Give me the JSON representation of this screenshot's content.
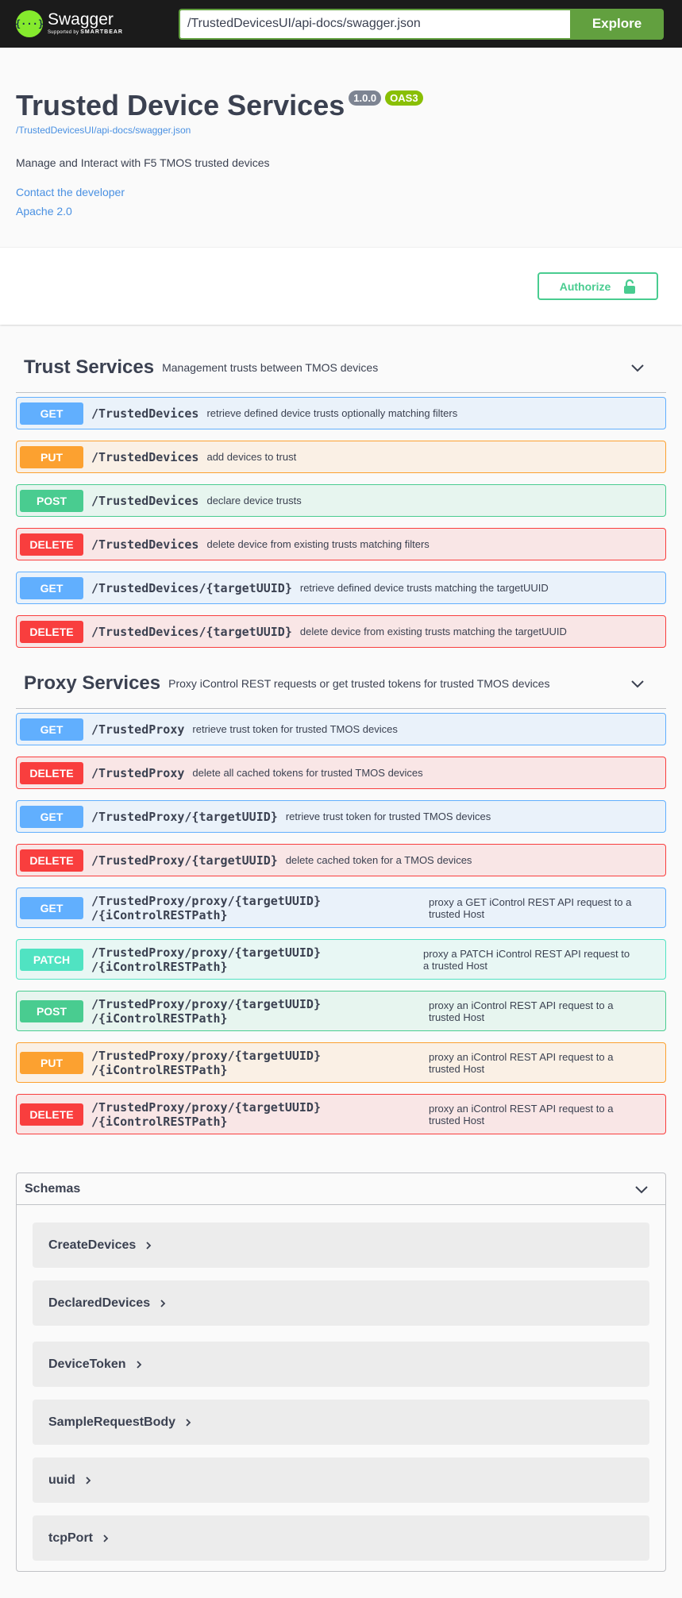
{
  "topbar": {
    "logo_title": "Swagger",
    "logo_supported": "Supported by",
    "logo_brand": "SMARTBEAR",
    "url_value": "/TrustedDevicesUI/api-docs/swagger.json",
    "explore_label": "Explore"
  },
  "info": {
    "title": "Trusted Device Services",
    "version": "1.0.0",
    "oas": "OAS3",
    "spec_url": "/TrustedDevicesUI/api-docs/swagger.json",
    "description": "Manage and Interact with F5 TMOS trusted devices",
    "contact_label": "Contact the developer",
    "license_label": "Apache 2.0"
  },
  "authorize_label": "Authorize",
  "tags": [
    {
      "name": "Trust Services",
      "description": "Management trusts between TMOS devices",
      "operations": [
        {
          "method": "GET",
          "path": "/TrustedDevices",
          "summary": "retrieve defined device trusts optionally matching filters"
        },
        {
          "method": "PUT",
          "path": "/TrustedDevices",
          "summary": "add devices to trust"
        },
        {
          "method": "POST",
          "path": "/TrustedDevices",
          "summary": "declare device trusts"
        },
        {
          "method": "DELETE",
          "path": "/TrustedDevices",
          "summary": "delete device from existing trusts matching filters"
        },
        {
          "method": "GET",
          "path": "/TrustedDevices/{targetUUID}",
          "summary": "retrieve defined device trusts matching the targetUUID"
        },
        {
          "method": "DELETE",
          "path": "/TrustedDevices/{targetUUID}",
          "summary": "delete device from existing trusts matching the targetUUID"
        }
      ]
    },
    {
      "name": "Proxy Services",
      "description": "Proxy iControl REST requests or get trusted tokens for trusted TMOS devices",
      "operations": [
        {
          "method": "GET",
          "path": "/TrustedProxy",
          "summary": "retrieve trust token for trusted TMOS devices"
        },
        {
          "method": "DELETE",
          "path": "/TrustedProxy",
          "summary": "delete all cached tokens for trusted TMOS devices"
        },
        {
          "method": "GET",
          "path": "/TrustedProxy/{targetUUID}",
          "summary": "retrieve trust token for trusted TMOS devices"
        },
        {
          "method": "DELETE",
          "path": "/TrustedProxy/{targetUUID}",
          "summary": "delete cached token for a TMOS devices"
        },
        {
          "method": "GET",
          "path_line1": "/TrustedProxy/proxy/{targetUUID}",
          "path_line2": "/{iControlRESTPath}",
          "summary": "proxy a GET iControl REST API request to a trusted Host"
        },
        {
          "method": "PATCH",
          "path_line1": "/TrustedProxy/proxy/{targetUUID}",
          "path_line2": "/{iControlRESTPath}",
          "summary": "proxy a PATCH iControl REST API request to a trusted Host"
        },
        {
          "method": "POST",
          "path_line1": "/TrustedProxy/proxy/{targetUUID}",
          "path_line2": "/{iControlRESTPath}",
          "summary": "proxy an iControl REST API request to a trusted Host"
        },
        {
          "method": "PUT",
          "path_line1": "/TrustedProxy/proxy/{targetUUID}",
          "path_line2": "/{iControlRESTPath}",
          "summary": "proxy an iControl REST API request to a trusted Host"
        },
        {
          "method": "DELETE",
          "path_line1": "/TrustedProxy/proxy/{targetUUID}",
          "path_line2": "/{iControlRESTPath}",
          "summary": "proxy an iControl REST API request to a trusted Host"
        }
      ]
    }
  ],
  "schemas": {
    "title": "Schemas",
    "items": [
      "CreateDevices",
      "DeclaredDevices",
      "DeviceToken",
      "SampleRequestBody",
      "uuid",
      "tcpPort"
    ]
  },
  "colors": {
    "get": "#61affe",
    "put": "#fca130",
    "post": "#49cc90",
    "delete": "#f93e3e",
    "patch": "#50e3c2",
    "topbar": "#1b1b1b",
    "explore": "#62a03f",
    "link": "#4990e2"
  },
  "icons": {
    "logo": "swagger-logo-icon",
    "lock": "lock-icon",
    "collapse": "chevron-down-icon",
    "expand": "chevron-right-icon"
  }
}
